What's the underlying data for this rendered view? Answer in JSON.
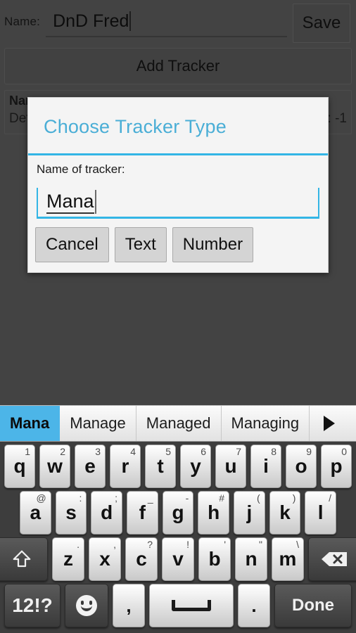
{
  "app": {
    "name_label": "Name:",
    "name_value": "DnD Fred",
    "save_label": "Save",
    "add_tracker_label": "Add Tracker"
  },
  "background_card": {
    "title_partial": "Nam",
    "subtitle_partial": "Def",
    "value_partial": ": -1"
  },
  "dialog": {
    "title": "Choose Tracker Type",
    "field_label": "Name of tracker:",
    "input_value": "Mana",
    "accent_color": "#33b5e5",
    "buttons": [
      {
        "label": "Cancel",
        "name": "cancel-button"
      },
      {
        "label": "Text",
        "name": "text-button"
      },
      {
        "label": "Number",
        "name": "number-button"
      }
    ]
  },
  "keyboard": {
    "suggestions": [
      {
        "label": "Mana",
        "active": true
      },
      {
        "label": "Manage",
        "active": false
      },
      {
        "label": "Managed",
        "active": false
      },
      {
        "label": "Managing",
        "active": false
      }
    ],
    "more_suggestions_icon": "triangle-right-icon",
    "row1": [
      {
        "key": "q",
        "hint": "1"
      },
      {
        "key": "w",
        "hint": "2"
      },
      {
        "key": "e",
        "hint": "3"
      },
      {
        "key": "r",
        "hint": "4"
      },
      {
        "key": "t",
        "hint": "5"
      },
      {
        "key": "y",
        "hint": "6"
      },
      {
        "key": "u",
        "hint": "7"
      },
      {
        "key": "i",
        "hint": "8"
      },
      {
        "key": "o",
        "hint": "9"
      },
      {
        "key": "p",
        "hint": "0"
      }
    ],
    "row2": [
      {
        "key": "a",
        "hint": "@"
      },
      {
        "key": "s",
        "hint": ":"
      },
      {
        "key": "d",
        "hint": ";"
      },
      {
        "key": "f",
        "hint": "_"
      },
      {
        "key": "g",
        "hint": "-"
      },
      {
        "key": "h",
        "hint": "#"
      },
      {
        "key": "j",
        "hint": "("
      },
      {
        "key": "k",
        "hint": ")"
      },
      {
        "key": "l",
        "hint": "/"
      }
    ],
    "row3": [
      {
        "key": "z",
        "hint": "."
      },
      {
        "key": "x",
        "hint": ","
      },
      {
        "key": "c",
        "hint": "?"
      },
      {
        "key": "v",
        "hint": "!"
      },
      {
        "key": "b",
        "hint": "'"
      },
      {
        "key": "n",
        "hint": "\""
      },
      {
        "key": "m",
        "hint": "\\"
      }
    ],
    "shift_icon": "shift-arrow-up-icon",
    "backspace_icon": "backspace-icon",
    "row4": {
      "symbols_label": "12!?",
      "emoji_icon": "smiley-icon",
      "comma_label": ",",
      "space_icon": "space-bar-icon",
      "period_label": ".",
      "done_label": "Done"
    }
  }
}
